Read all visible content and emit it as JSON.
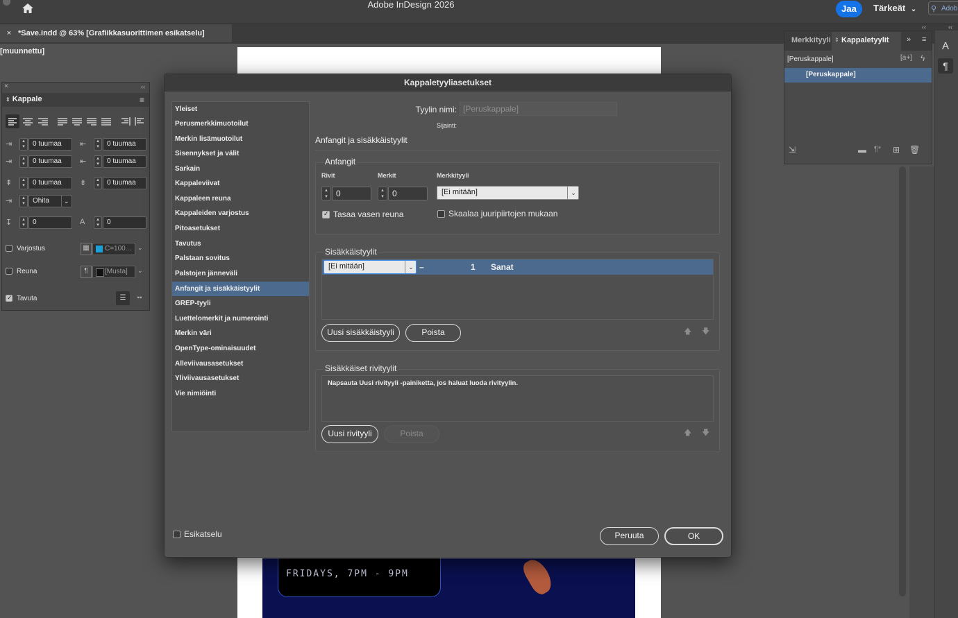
{
  "app": {
    "title": "Adobe InDesign 2026",
    "share_label": "Jaa",
    "workspace_label": "Tärkeät",
    "search_text": "Adob"
  },
  "doc_tab": {
    "close": "×",
    "title": "*Save.indd @ 63% [Grafiikkasuorittimen esikatselu] [muunnettu]"
  },
  "canvas": {
    "poster_text": "FRIDAYS, 7PM - 9PM"
  },
  "kappale_panel": {
    "close": "×",
    "collapse": "‹‹",
    "title": "Kappale",
    "left_indent": "0 tuumaa",
    "right_indent": "0 tuumaa",
    "first_line_indent": "0 tuumaa",
    "last_line_indent": "0 tuumaa",
    "space_before": "0 tuumaa",
    "space_after": "0 tuumaa",
    "grid_align": "Ohita",
    "dropcap_lines": "0",
    "dropcap_chars": "0",
    "shading_label": "Varjostus",
    "shading_color": "C=100...",
    "border_label": "Reuna",
    "border_color": "[Musta]",
    "hyphenate_label": "Tavuta"
  },
  "styles_panel": {
    "tab_char": "Merkkityyli",
    "tab_para": "Kappaletyylit",
    "current": "[Peruskappale]",
    "item": "[Peruskappale]"
  },
  "dialog": {
    "title": "Kappaletyyliasetukset",
    "categories": [
      "Yleiset",
      "Perusmerkkimuotoilut",
      "Merkin lisämuotoilut",
      "Sisennykset ja välit",
      "Sarkain",
      "Kappaleviivat",
      "Kappaleen reuna",
      "Kappaleiden varjostus",
      "Pitoasetukset",
      "Tavutus",
      "Palstaan sovitus",
      "Palstojen jänneväli",
      "Anfangit ja sisäkkäistyylit",
      "GREP-tyyli",
      "Luettelomerkit ja numerointi",
      "Merkin väri",
      "OpenType-ominaisuudet",
      "Alleviivausasetukset",
      "Yliviivausasetukset",
      "Vie nimiöinti"
    ],
    "selected_category_index": 12,
    "style_name_label": "Tyylin nimi:",
    "style_name_value": "[Peruskappale]",
    "location_label": "Sijainti:",
    "section_title": "Anfangit ja sisäkkäistyylit",
    "dropcaps": {
      "title": "Anfangit",
      "rows_label": "Rivit",
      "chars_label": "Merkit",
      "charstyle_label": "Merkkityyli",
      "rows_value": "0",
      "chars_value": "0",
      "charstyle_value": "[Ei mitään]",
      "align_left_label": "Tasaa vasen reuna",
      "align_left_checked": true,
      "scale_label": "Skaalaa juuripiirtojen mukaan",
      "scale_checked": false
    },
    "nested": {
      "title": "Sisäkkäistyylit",
      "row_style": "[Ei mitään]",
      "row_dash": "–",
      "row_count": "1",
      "row_unit": "Sanat",
      "new_button": "Uusi sisäkkäistyyli",
      "delete_button": "Poista"
    },
    "nested_line": {
      "title": "Sisäkkäiset rivityylit",
      "hint": "Napsauta Uusi rivityyli -painiketta, jos haluat luoda rivityylin.",
      "new_button": "Uusi rivityyli",
      "delete_button": "Poista"
    },
    "preview_label": "Esikatselu",
    "preview_checked": false,
    "cancel_button": "Peruuta",
    "ok_button": "OK"
  }
}
